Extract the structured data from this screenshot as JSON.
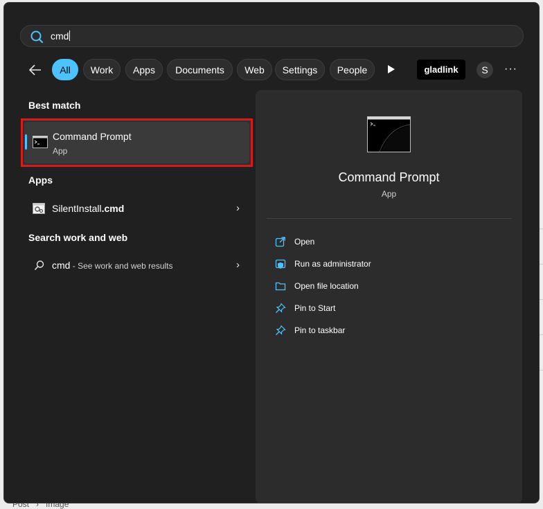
{
  "search": {
    "query": "cmd"
  },
  "filters": {
    "chips": [
      "All",
      "Work",
      "Apps",
      "Documents",
      "Web",
      "Settings",
      "People"
    ],
    "account_badge": "gladlink",
    "avatar_initial": "S",
    "more": "···"
  },
  "results": {
    "best_match_heading": "Best match",
    "best_match": {
      "name": "Command Prompt",
      "type": "App"
    },
    "apps_heading": "Apps",
    "apps": [
      {
        "name_prefix": "SilentInstall",
        "name_ext": ".cmd"
      }
    ],
    "web_heading": "Search work and web",
    "web": {
      "query": "cmd",
      "suffix": " - See work and web results"
    }
  },
  "details": {
    "title": "Command Prompt",
    "type": "App",
    "actions": [
      "Open",
      "Run as administrator",
      "Open file location",
      "Pin to Start",
      "Pin to taskbar"
    ]
  },
  "background": {
    "crumb": [
      "Post",
      "Image"
    ]
  },
  "colors": {
    "accent": "#4cc2ff",
    "highlight": "#d11d1d",
    "panel": "#202020"
  }
}
